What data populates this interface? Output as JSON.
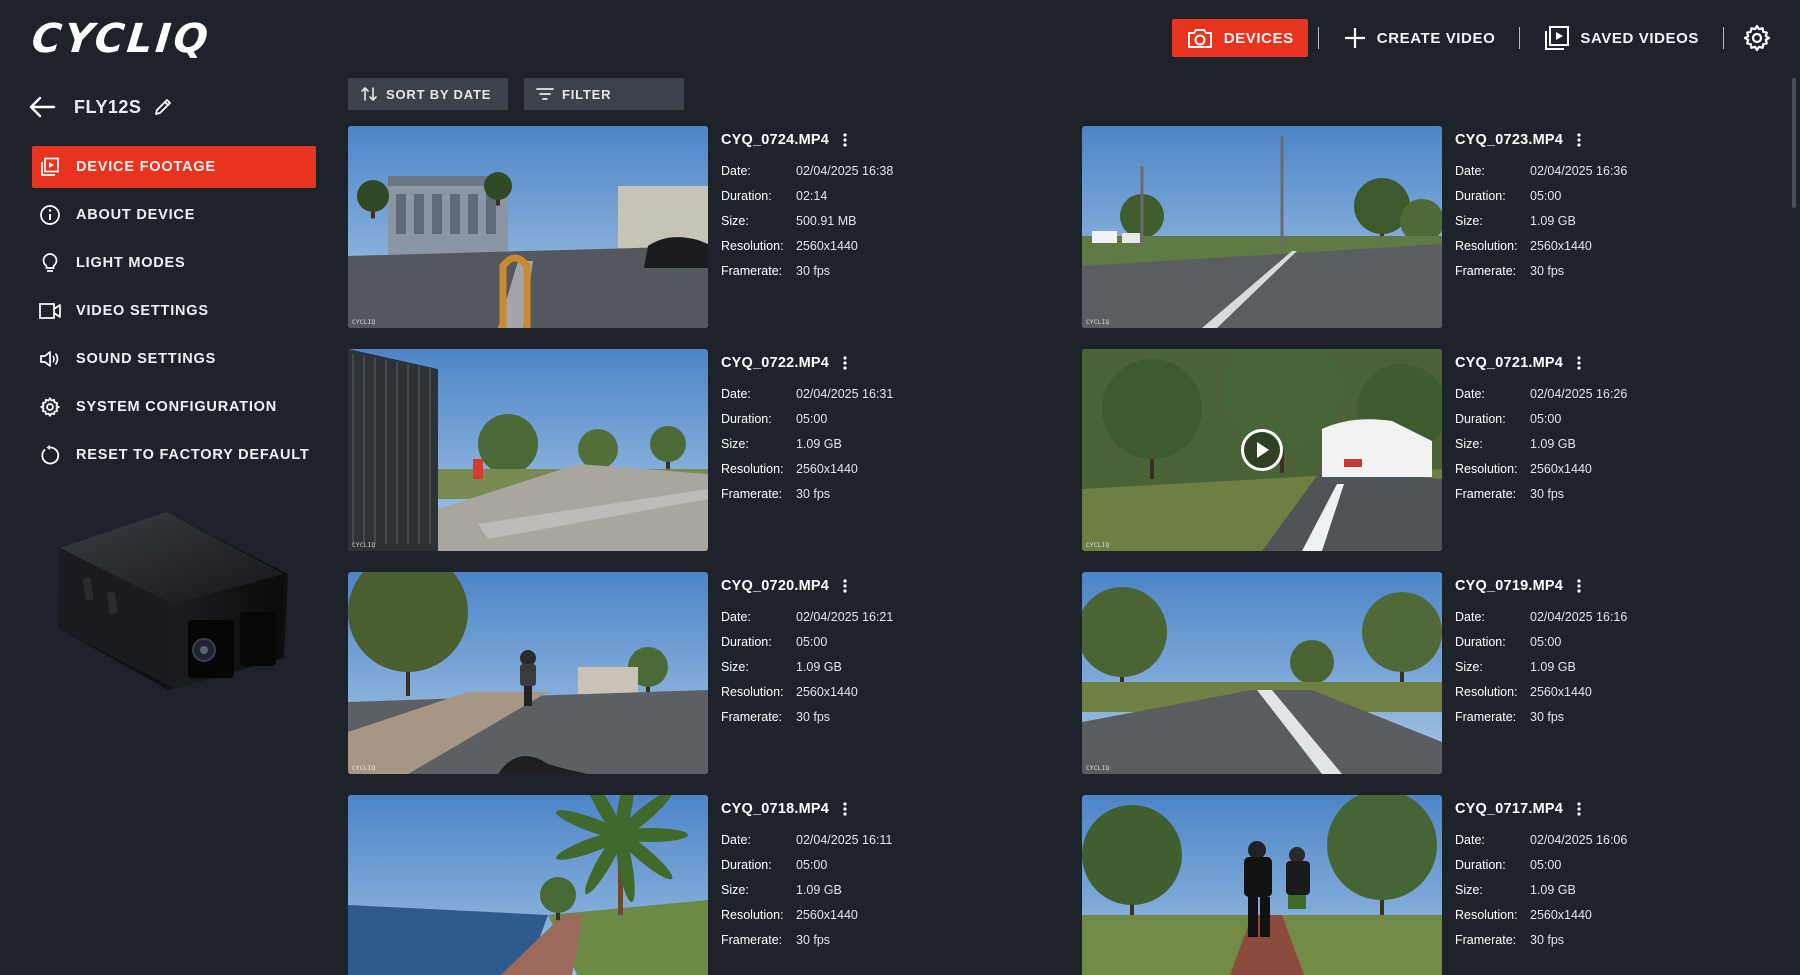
{
  "app": {
    "logo": "CYCLIQ"
  },
  "colors": {
    "accent": "#e8331e",
    "background": "#1e232b",
    "toolbar_button": "#3c424b"
  },
  "nav": {
    "devices": "DEVICES",
    "create_video": "CREATE VIDEO",
    "saved_videos": "SAVED VIDEOS"
  },
  "device": {
    "name": "FLY12S"
  },
  "sidebar": {
    "items": [
      {
        "label": "DEVICE FOOTAGE",
        "icon": "video-library-icon",
        "active": true
      },
      {
        "label": "ABOUT DEVICE",
        "icon": "info-icon",
        "active": false
      },
      {
        "label": "LIGHT MODES",
        "icon": "lightbulb-icon",
        "active": false
      },
      {
        "label": "VIDEO SETTINGS",
        "icon": "video-camera-icon",
        "active": false
      },
      {
        "label": "SOUND SETTINGS",
        "icon": "speaker-icon",
        "active": false
      },
      {
        "label": "SYSTEM CONFIGURATION",
        "icon": "gear-icon",
        "active": false
      },
      {
        "label": "RESET TO FACTORY DEFAULT",
        "icon": "reset-icon",
        "active": false
      }
    ]
  },
  "toolbar": {
    "sort_label": "SORT BY DATE",
    "filter_label": "FILTER"
  },
  "labels": {
    "date": "Date:",
    "duration": "Duration:",
    "size": "Size:",
    "resolution": "Resolution:",
    "framerate": "Framerate:"
  },
  "videos": [
    {
      "name": "CYQ_0724.MP4",
      "date": "02/04/2025 16:38",
      "duration": "02:14",
      "size": "500.91 MB",
      "resolution": "2560x1440",
      "framerate": "30 fps",
      "scene": "urban"
    },
    {
      "name": "CYQ_0723.MP4",
      "date": "02/04/2025 16:36",
      "duration": "05:00",
      "size": "1.09 GB",
      "resolution": "2560x1440",
      "framerate": "30 fps",
      "scene": "road"
    },
    {
      "name": "CYQ_0722.MP4",
      "date": "02/04/2025 16:31",
      "duration": "05:00",
      "size": "1.09 GB",
      "resolution": "2560x1440",
      "framerate": "30 fps",
      "scene": "path-fence"
    },
    {
      "name": "CYQ_0721.MP4",
      "date": "02/04/2025 16:26",
      "duration": "05:00",
      "size": "1.09 GB",
      "resolution": "2560x1440",
      "framerate": "30 fps",
      "scene": "car-trees",
      "hover_play": true
    },
    {
      "name": "CYQ_0720.MP4",
      "date": "02/04/2025 16:21",
      "duration": "05:00",
      "size": "1.09 GB",
      "resolution": "2560x1440",
      "framerate": "30 fps",
      "scene": "cyclist-tree"
    },
    {
      "name": "CYQ_0719.MP4",
      "date": "02/04/2025 16:16",
      "duration": "05:00",
      "size": "1.09 GB",
      "resolution": "2560x1440",
      "framerate": "30 fps",
      "scene": "park-road"
    },
    {
      "name": "CYQ_0718.MP4",
      "date": "02/04/2025 16:11",
      "duration": "05:00",
      "size": "1.09 GB",
      "resolution": "2560x1440",
      "framerate": "30 fps",
      "scene": "river-palm"
    },
    {
      "name": "CYQ_0717.MP4",
      "date": "02/04/2025 16:06",
      "duration": "05:00",
      "size": "1.09 GB",
      "resolution": "2560x1440",
      "framerate": "30 fps",
      "scene": "cyclists"
    }
  ]
}
